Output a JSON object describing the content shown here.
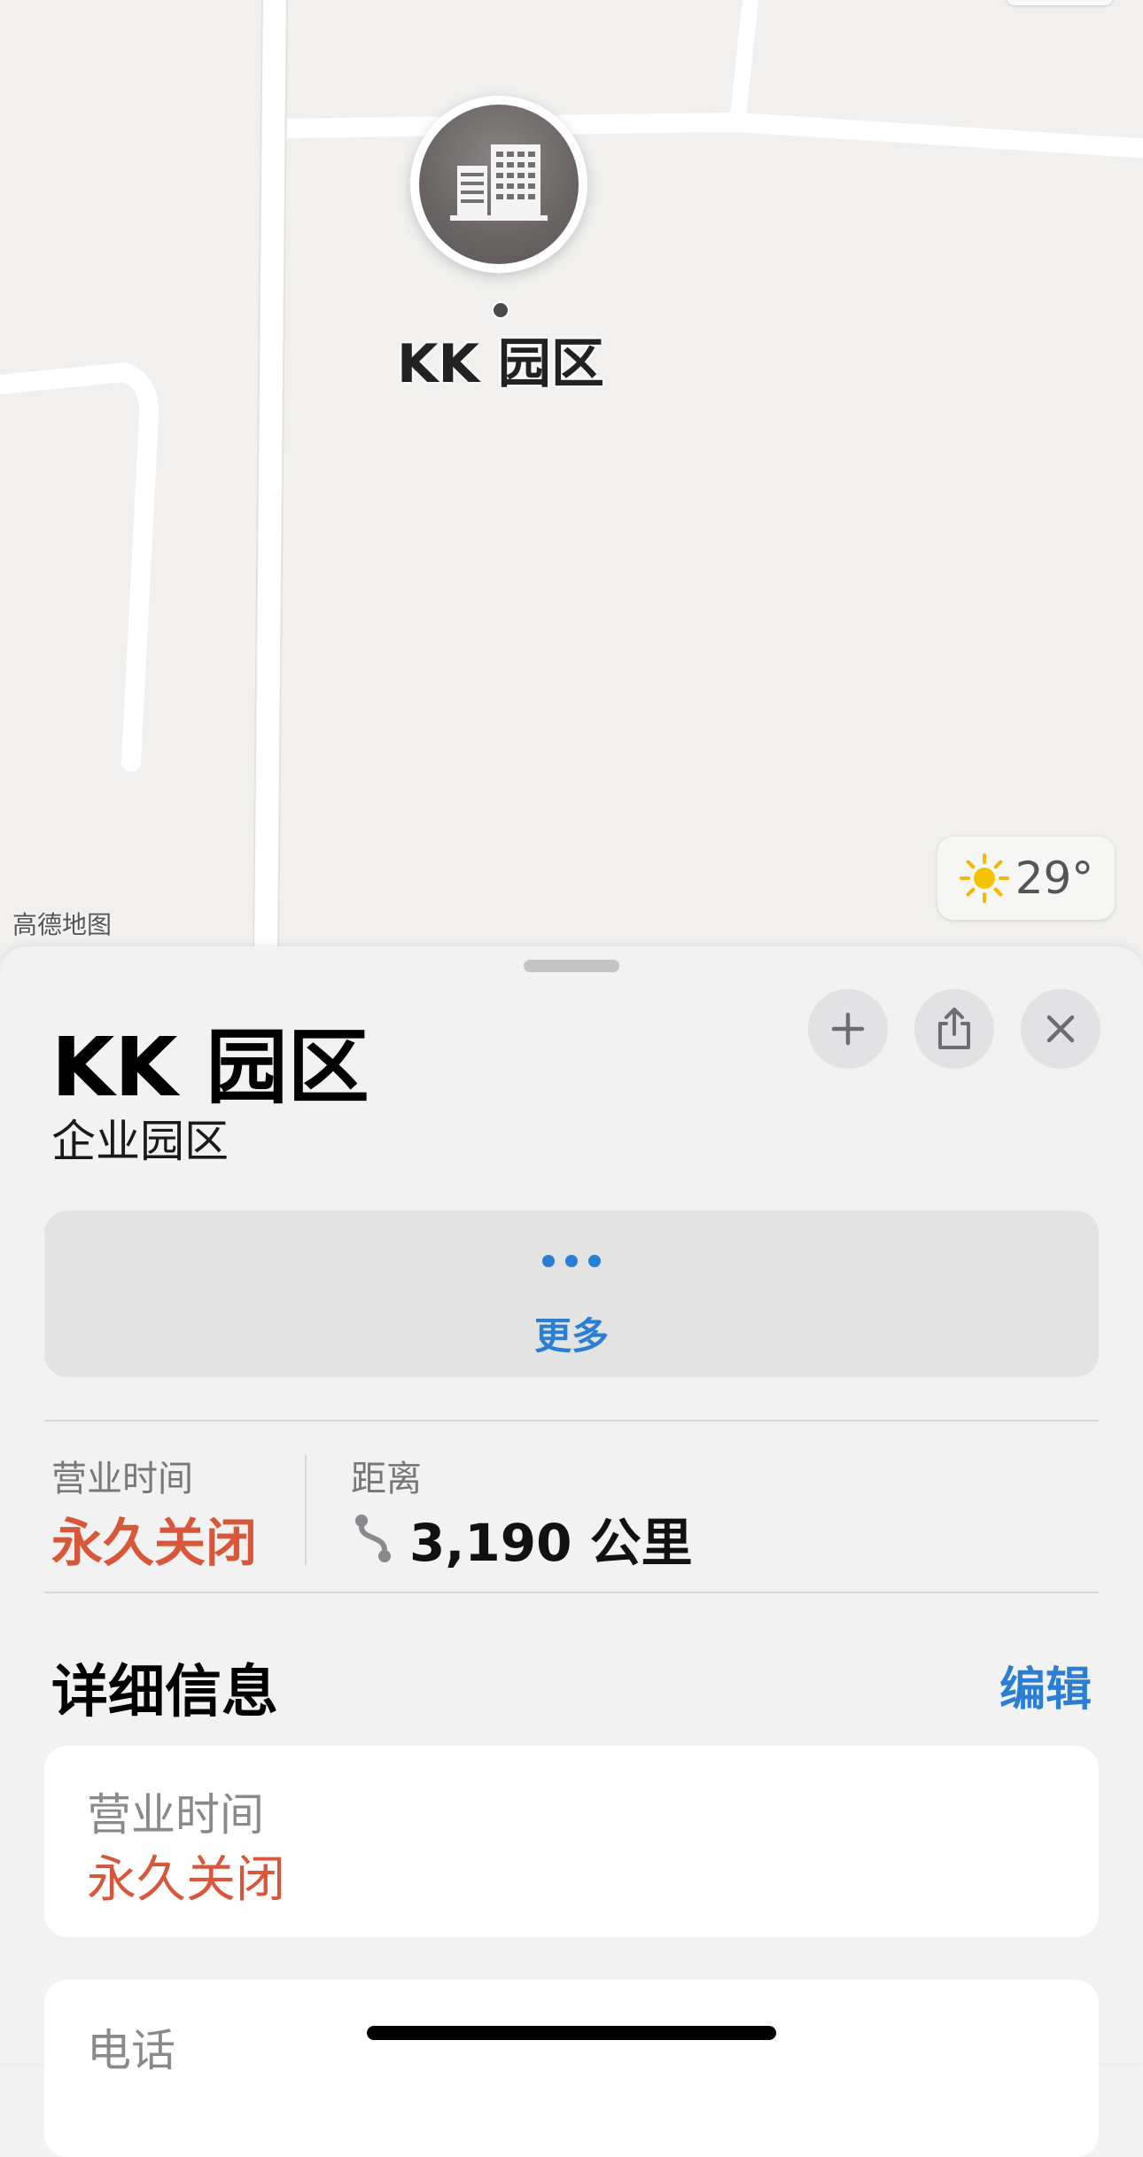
{
  "map": {
    "pin_label": "KK 园区",
    "attribution": "高德地图",
    "weather": {
      "icon": "sun-icon",
      "temperature": "29°"
    }
  },
  "place": {
    "title": "KK 园区",
    "category": "企业园区"
  },
  "actions": {
    "add_icon": "plus-icon",
    "share_icon": "share-icon",
    "close_icon": "close-icon",
    "more_label": "更多"
  },
  "summary": {
    "hours_label": "营业时间",
    "hours_value": "永久关闭",
    "distance_label": "距离",
    "distance_value": "3,190 公里"
  },
  "details": {
    "section_title": "详细信息",
    "edit_label": "编辑",
    "hours_label": "营业时间",
    "hours_value": "永久关闭",
    "phone_label": "电话"
  },
  "colors": {
    "accent_blue": "#2a7fd4",
    "closed_red": "#d8573a"
  }
}
